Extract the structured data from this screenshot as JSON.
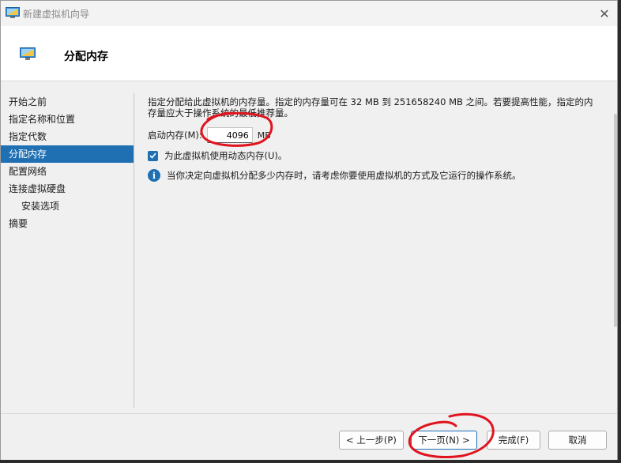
{
  "window": {
    "title": "新建虚拟机向导",
    "close_glyph": "✕"
  },
  "header": {
    "title": "分配内存"
  },
  "nav": {
    "items": [
      {
        "label": "开始之前"
      },
      {
        "label": "指定名称和位置"
      },
      {
        "label": "指定代数"
      },
      {
        "label": "分配内存"
      },
      {
        "label": "配置网络"
      },
      {
        "label": "连接虚拟硬盘"
      },
      {
        "label": "安装选项"
      },
      {
        "label": "摘要"
      }
    ],
    "active_index": 3
  },
  "main": {
    "description": "指定分配给此虚拟机的内存量。指定的内存量可在 32 MB 到 251658240 MB 之间。若要提高性能，指定的内存量应大于操作系统的最低推荐量。",
    "startup_memory_label": "启动内存(M):",
    "startup_memory_value": "4096",
    "startup_memory_unit": "MB",
    "dynamic_memory_label": "为此虚拟机使用动态内存(U)。",
    "dynamic_memory_checked": true,
    "info_text": "当你决定向虚拟机分配多少内存时，请考虑你要使用虚拟机的方式及它运行的操作系统。",
    "info_glyph": "i"
  },
  "footer": {
    "prev_label": "< 上一步(P)",
    "next_label": "下一页(N) >",
    "finish_label": "完成(F)",
    "cancel_label": "取消"
  },
  "colors": {
    "accent": "#1f6fb3",
    "annotation": "#e0141e"
  }
}
